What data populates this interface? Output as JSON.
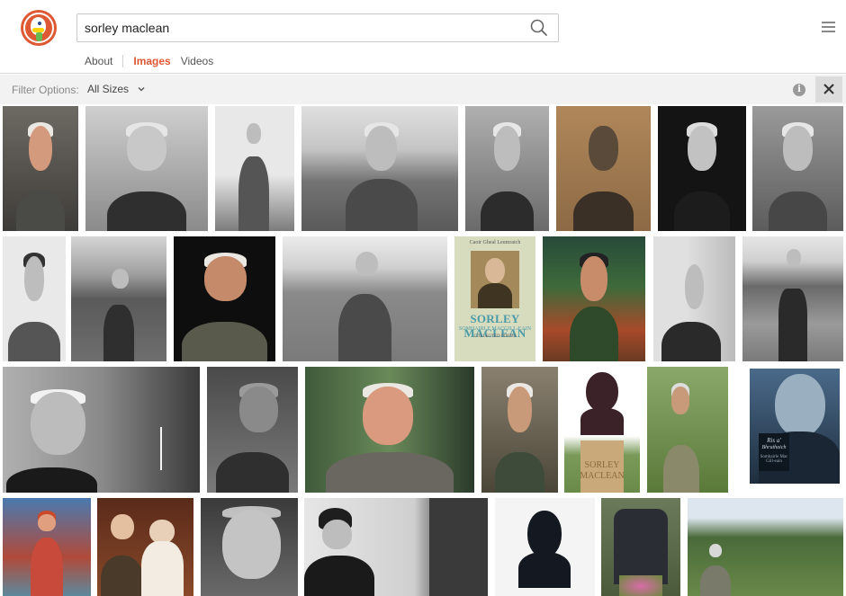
{
  "search": {
    "query": "sorley maclean"
  },
  "tabs": [
    {
      "label": "About",
      "active": false
    },
    {
      "label": "Images",
      "active": true
    },
    {
      "label": "Videos",
      "active": false
    }
  ],
  "filter": {
    "label": "Filter Options:",
    "value": "All Sizes"
  },
  "icons": {
    "logo": "duckduckgo-logo",
    "search": "search-icon",
    "menu": "hamburger-menu-icon",
    "info": "info-icon",
    "close": "close-icon",
    "chevron": "chevron-down-icon"
  },
  "colors": {
    "accent": "#de5833",
    "filter_bg": "#f2f2f2"
  },
  "results": {
    "book_cover": {
      "top_text": "Caoir Gheal Leumraich",
      "author": "SORLEY MACLEAN",
      "gaelic_name": "SOMHAIRLE MACGILL-EAIN",
      "subtitle": "COLLECTED POEMS"
    },
    "bust_plinth": {
      "line1": "SORLEY",
      "line2": "MACLEAN"
    },
    "dark_book": {
      "line1": "Ris a'",
      "line2": "Bhruthaich",
      "line3": "Somhairle Mac Gill-eain"
    }
  }
}
